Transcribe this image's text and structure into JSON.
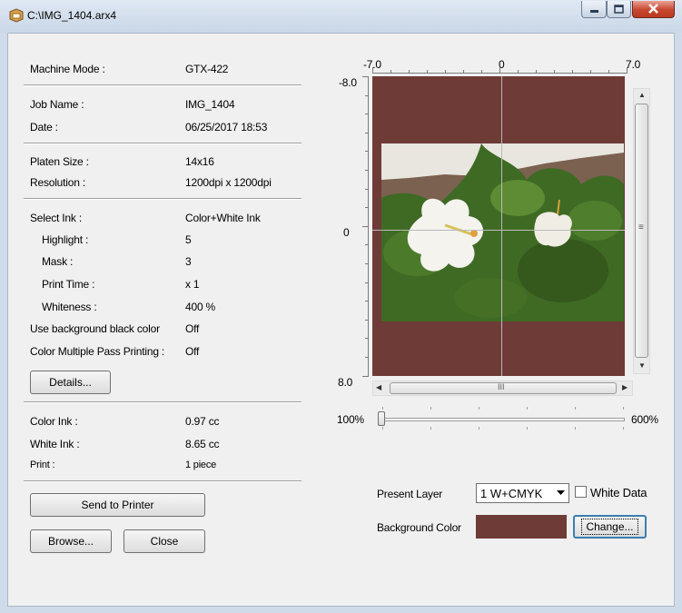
{
  "window": {
    "title": "C:\\IMG_1404.arx4"
  },
  "info": {
    "machine_mode": {
      "label": "Machine Mode :",
      "value": "GTX-422"
    },
    "job_name": {
      "label": "Job Name :",
      "value": "IMG_1404"
    },
    "date": {
      "label": "Date :",
      "value": "06/25/2017 18:53"
    },
    "platen_size": {
      "label": "Platen Size :",
      "value": "14x16"
    },
    "resolution": {
      "label": "Resolution :",
      "value": "1200dpi x 1200dpi"
    },
    "select_ink": {
      "label": "Select Ink :",
      "value": "Color+White Ink"
    },
    "highlight": {
      "label": "Highlight :",
      "value": "5"
    },
    "mask": {
      "label": "Mask :",
      "value": "3"
    },
    "print_time": {
      "label": "Print Time :",
      "value": "x 1"
    },
    "whiteness": {
      "label": "Whiteness :",
      "value": "400 %"
    },
    "use_bg_black": {
      "label": "Use background black color",
      "value": "Off"
    },
    "multi_pass": {
      "label": "Color Multiple Pass Printing :",
      "value": "Off"
    },
    "color_ink": {
      "label": "Color Ink :",
      "value": "0.97 cc"
    },
    "white_ink": {
      "label": "White Ink :",
      "value": "8.65 cc"
    },
    "print": {
      "label": "Print :",
      "value": "1 piece"
    }
  },
  "buttons": {
    "details": "Details...",
    "send_to_printer": "Send to Printer",
    "browse": "Browse...",
    "close": "Close",
    "change": "Change..."
  },
  "preview": {
    "x_min_label": "-7.0",
    "x_mid_label": "0",
    "x_max_label": "7.0",
    "y_min_label": "-8.0",
    "y_mid_label": "0",
    "y_max_label": "8.0",
    "background_color": "#6e3b37",
    "hscroll_thumb_glyph": "III",
    "vscroll_thumb_glyph": "≡"
  },
  "zoom": {
    "min_label": "100%",
    "max_label": "600%",
    "value_percent": 100
  },
  "layer": {
    "present_layer_label": "Present Layer",
    "selected": "1  W+CMYK",
    "white_data_label": "White Data",
    "white_data_checked": false,
    "background_color_label": "Background Color",
    "background_color": "#6e3b37"
  }
}
